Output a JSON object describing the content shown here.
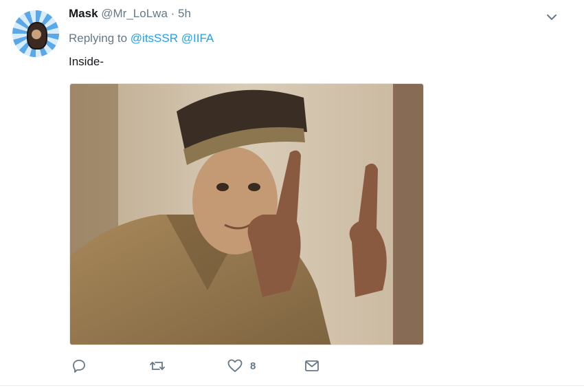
{
  "tweet": {
    "name": "Mask",
    "handle": "@Mr_LoLwa",
    "separator": "·",
    "time": "5h",
    "replying_prefix": "Replying to",
    "replying_to": [
      "@itsSSR",
      "@IIFA"
    ],
    "text": "Inside-",
    "likes_count": "8"
  },
  "icons": {
    "more": "chevron-down-icon",
    "reply": "reply-icon",
    "retweet": "retweet-icon",
    "like": "heart-icon",
    "message": "envelope-icon"
  },
  "colors": {
    "link": "#1da1f2",
    "secondary_text": "#657786",
    "primary_text": "#14171a"
  }
}
